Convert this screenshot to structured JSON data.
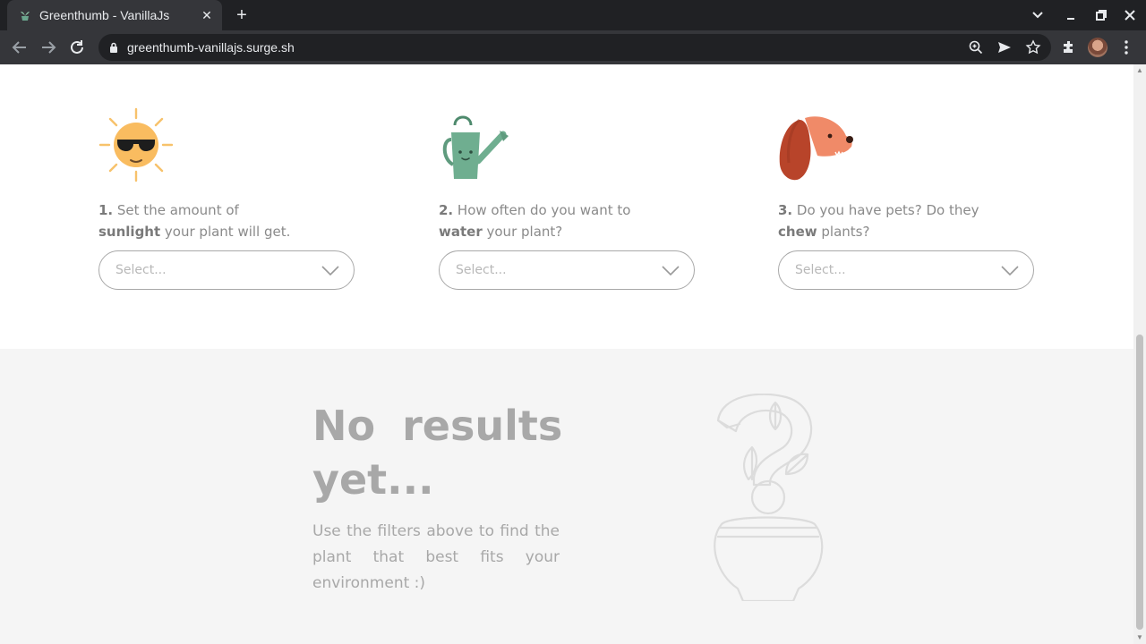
{
  "browser": {
    "tab_title": "Greenthumb - VanillaJs",
    "url": "greenthumb-vanillajs.surge.sh",
    "icons": [
      "plant-favicon-icon",
      "close-icon",
      "plus-icon",
      "chevron-down-icon",
      "minimize-icon",
      "restore-icon",
      "window-close-icon",
      "back-icon",
      "forward-icon",
      "reload-icon",
      "lock-icon",
      "zoom-icon",
      "send-icon",
      "star-icon",
      "extensions-icon",
      "avatar",
      "more-icon"
    ]
  },
  "filters": [
    {
      "num": "1.",
      "text_a": " Set the amount of ",
      "bold": "sunlight",
      "text_b": " your plant will get.",
      "select_placeholder": "Select...",
      "icon": "sun-sunglasses-icon"
    },
    {
      "num": "2.",
      "text_a": " How often do you want to ",
      "bold": "water",
      "text_b": " your plant?",
      "select_placeholder": "Select...",
      "icon": "watering-can-icon"
    },
    {
      "num": "3.",
      "text_a": " Do you have pets? Do they ",
      "bold": "chew",
      "text_b": " plants?",
      "select_placeholder": "Select...",
      "icon": "dog-icon"
    }
  ],
  "results": {
    "title": "No results yet...",
    "text": "Use the filters above to find the plant that best fits your environment :)",
    "illustration": "question-plant-pot-icon"
  },
  "colors": {
    "chrome_dark": "#202124",
    "chrome_mid": "#35363a",
    "muted_text": "#a8a8a8",
    "results_bg": "#f5f5f5"
  }
}
